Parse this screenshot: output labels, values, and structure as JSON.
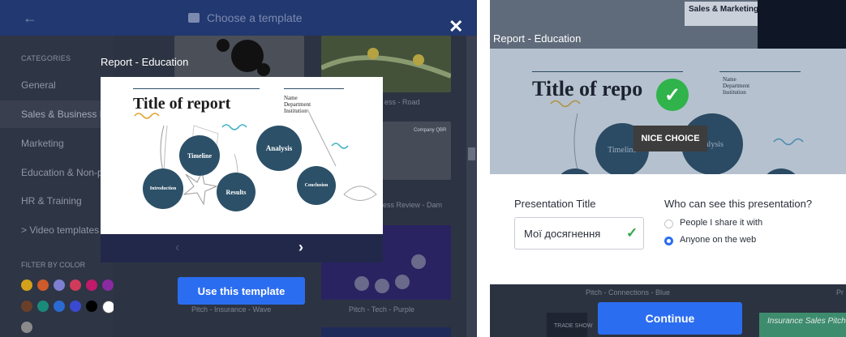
{
  "left_window": {
    "header": {
      "back_icon": "arrow-left-icon",
      "title": "Choose a template",
      "template_icon": "template-icon",
      "close_icon": "close-icon",
      "close_label": "✕"
    },
    "sidebar": {
      "categories_heading": "CATEGORIES",
      "categories": [
        {
          "label": "General"
        },
        {
          "label": "Sales & Business De"
        },
        {
          "label": "Marketing"
        },
        {
          "label": "Education & Non-pr"
        },
        {
          "label": "HR & Training"
        },
        {
          "label": "> Video templates"
        }
      ],
      "selected_category": "Sales & Business De",
      "filter_heading": "FILTER BY COLOR",
      "color_swatches": [
        "#d4a21a",
        "#cf5a2a",
        "#7d7fd0",
        "#d13b5a",
        "#c01a6a",
        "#8a2aa0",
        "#6a3f2a",
        "#1a8a7a",
        "#2b6ad0",
        "#3a4ad0",
        "#000000",
        "#ffffff",
        "#8a8a8a"
      ]
    },
    "grid_captions": {
      "road": "ess - Road",
      "dam": "ess Review - Dam",
      "insurance": "Pitch - Insurance - Wave",
      "tech": "Pitch - Tech - Purple",
      "qbr_label": "Company QBR"
    },
    "preview": {
      "label": "Report - Education",
      "slide_title": "Title of report",
      "meta_lines": [
        "Name",
        "Department",
        "Institution"
      ],
      "circles": [
        "Timeline",
        "Analysis",
        "Introduction",
        "Results",
        "Conclusion"
      ],
      "prev_icon": "chevron-left-icon",
      "next_icon": "chevron-right-icon",
      "prev_label": "‹",
      "next_label": "›"
    },
    "use_button": "Use this template"
  },
  "right_window": {
    "label": "Report - Education",
    "background_strip": "Sales & Marketing Proposal",
    "slide_title": "Title of repo",
    "meta_lines": [
      "Name",
      "Department",
      "Institution"
    ],
    "circles": [
      "Timeline",
      "nalysis"
    ],
    "check_icon": "check-icon",
    "check_label": "✓",
    "nice_choice": "NICE CHOICE",
    "form": {
      "title_label": "Presentation Title",
      "title_value": "Мої досягнення",
      "valid_icon": "check-icon",
      "valid_label": "✓",
      "visibility_label": "Who can see this presentation?",
      "options": [
        {
          "label": "People I share it with",
          "selected": false
        },
        {
          "label": "Anyone on the web",
          "selected": true
        }
      ]
    },
    "caption": "Pitch - Connections - Blue",
    "caption_right": "Pr",
    "bottom_thumb_left": "TRADE SHOW",
    "bottom_thumb_right": "Insurance Sales Pitch",
    "continue_button": "Continue"
  }
}
